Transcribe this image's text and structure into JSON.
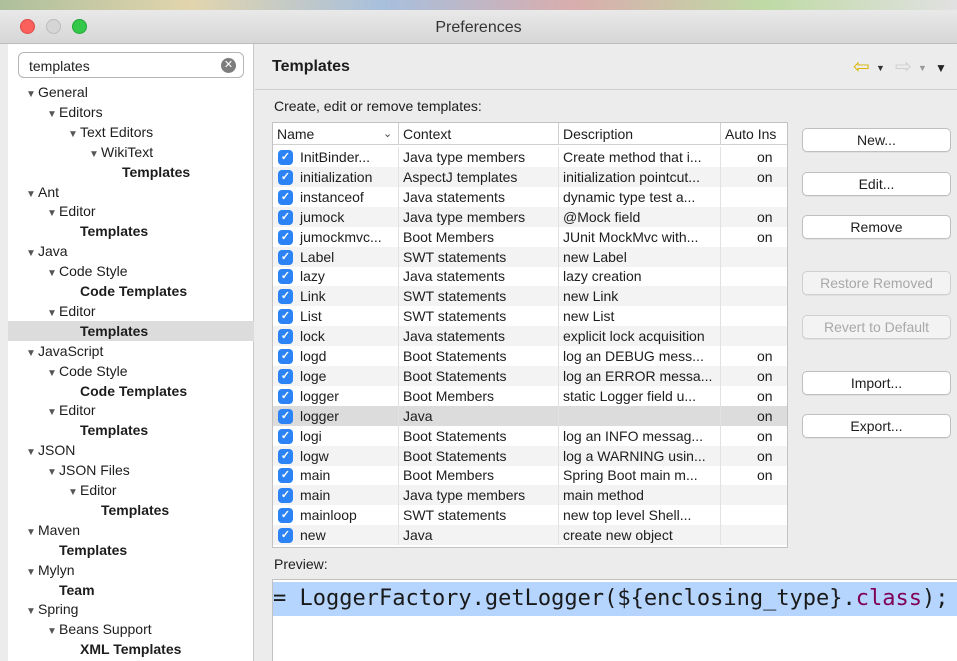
{
  "window": {
    "title": "Preferences"
  },
  "search": {
    "value": "templates"
  },
  "tree": [
    {
      "label": "General",
      "indent": 0,
      "arrow": true,
      "bold": false
    },
    {
      "label": "Editors",
      "indent": 1,
      "arrow": true,
      "bold": false
    },
    {
      "label": "Text Editors",
      "indent": 2,
      "arrow": true,
      "bold": false
    },
    {
      "label": "WikiText",
      "indent": 3,
      "arrow": true,
      "bold": false
    },
    {
      "label": "Templates",
      "indent": 4,
      "arrow": false,
      "bold": true
    },
    {
      "label": "Ant",
      "indent": 0,
      "arrow": true,
      "bold": false
    },
    {
      "label": "Editor",
      "indent": 1,
      "arrow": true,
      "bold": false
    },
    {
      "label": "Templates",
      "indent": 2,
      "arrow": false,
      "bold": true
    },
    {
      "label": "Java",
      "indent": 0,
      "arrow": true,
      "bold": false
    },
    {
      "label": "Code Style",
      "indent": 1,
      "arrow": true,
      "bold": false
    },
    {
      "label": "Code Templates",
      "indent": 2,
      "arrow": false,
      "bold": true
    },
    {
      "label": "Editor",
      "indent": 1,
      "arrow": true,
      "bold": false
    },
    {
      "label": "Templates",
      "indent": 2,
      "arrow": false,
      "bold": true,
      "selected": true
    },
    {
      "label": "JavaScript",
      "indent": 0,
      "arrow": true,
      "bold": false
    },
    {
      "label": "Code Style",
      "indent": 1,
      "arrow": true,
      "bold": false
    },
    {
      "label": "Code Templates",
      "indent": 2,
      "arrow": false,
      "bold": true
    },
    {
      "label": "Editor",
      "indent": 1,
      "arrow": true,
      "bold": false
    },
    {
      "label": "Templates",
      "indent": 2,
      "arrow": false,
      "bold": true
    },
    {
      "label": "JSON",
      "indent": 0,
      "arrow": true,
      "bold": false
    },
    {
      "label": "JSON Files",
      "indent": 1,
      "arrow": true,
      "bold": false
    },
    {
      "label": "Editor",
      "indent": 2,
      "arrow": true,
      "bold": false
    },
    {
      "label": "Templates",
      "indent": 3,
      "arrow": false,
      "bold": true
    },
    {
      "label": "Maven",
      "indent": 0,
      "arrow": true,
      "bold": false
    },
    {
      "label": "Templates",
      "indent": 1,
      "arrow": false,
      "bold": true
    },
    {
      "label": "Mylyn",
      "indent": 0,
      "arrow": true,
      "bold": false
    },
    {
      "label": "Team",
      "indent": 1,
      "arrow": false,
      "bold": true
    },
    {
      "label": "Spring",
      "indent": 0,
      "arrow": true,
      "bold": false
    },
    {
      "label": "Beans Support",
      "indent": 1,
      "arrow": true,
      "bold": false
    },
    {
      "label": "XML Templates",
      "indent": 2,
      "arrow": false,
      "bold": true
    }
  ],
  "page": {
    "title": "Templates",
    "description": "Create, edit or remove templates:"
  },
  "table": {
    "headers": {
      "name": "Name",
      "context": "Context",
      "description": "Description",
      "auto": "Auto Ins"
    },
    "rows": [
      {
        "name": "InitBinder...",
        "context": "Java type members",
        "description": "Create method that i...",
        "auto": "on"
      },
      {
        "name": "initialization",
        "context": "AspectJ templates",
        "description": "initialization pointcut...",
        "auto": "on"
      },
      {
        "name": "instanceof",
        "context": "Java statements",
        "description": "dynamic type test a...",
        "auto": ""
      },
      {
        "name": "jumock",
        "context": "Java type members",
        "description": "@Mock field",
        "auto": "on"
      },
      {
        "name": "jumockmvc...",
        "context": "Boot Members",
        "description": "JUnit MockMvc with...",
        "auto": "on"
      },
      {
        "name": "Label",
        "context": "SWT statements",
        "description": "new Label",
        "auto": ""
      },
      {
        "name": "lazy",
        "context": "Java statements",
        "description": "lazy creation",
        "auto": ""
      },
      {
        "name": "Link",
        "context": "SWT statements",
        "description": "new Link",
        "auto": ""
      },
      {
        "name": "List",
        "context": "SWT statements",
        "description": "new List",
        "auto": ""
      },
      {
        "name": "lock",
        "context": "Java statements",
        "description": "explicit lock acquisition",
        "auto": ""
      },
      {
        "name": "logd",
        "context": "Boot Statements",
        "description": "log an DEBUG mess...",
        "auto": "on"
      },
      {
        "name": "loge",
        "context": "Boot Statements",
        "description": "log an ERROR messa...",
        "auto": "on"
      },
      {
        "name": "logger",
        "context": "Boot Members",
        "description": "static Logger field u...",
        "auto": "on"
      },
      {
        "name": "logger",
        "context": "Java",
        "description": "",
        "auto": "on",
        "selected": true
      },
      {
        "name": "logi",
        "context": "Boot Statements",
        "description": "log an INFO messag...",
        "auto": "on"
      },
      {
        "name": "logw",
        "context": "Boot Statements",
        "description": "log a WARNING usin...",
        "auto": "on"
      },
      {
        "name": "main",
        "context": "Boot Members",
        "description": "Spring Boot main m...",
        "auto": "on"
      },
      {
        "name": "main",
        "context": "Java type members",
        "description": "main method",
        "auto": ""
      },
      {
        "name": "mainloop",
        "context": "SWT statements",
        "description": "new top level Shell...",
        "auto": ""
      },
      {
        "name": "new",
        "context": "Java",
        "description": "create new object",
        "auto": ""
      }
    ]
  },
  "buttons": {
    "new": "New...",
    "edit": "Edit...",
    "remove": "Remove",
    "restore": "Restore Removed",
    "revert": "Revert to Default",
    "import": "Import...",
    "export": "Export..."
  },
  "preview": {
    "label": "Preview:",
    "prefix": "= LoggerFactory.getLogger(${enclosing_type}.",
    "keyword": "class",
    "suffix": ");"
  },
  "colors": {
    "checkbox": "#2b83f6",
    "selection": "#dcdcdc",
    "preview_highlight": "#b5d5ff",
    "keyword": "#7f0055"
  },
  "icons": {
    "back": "back-arrow-icon",
    "forward": "forward-arrow-icon",
    "view_menu": "view-menu-icon"
  }
}
